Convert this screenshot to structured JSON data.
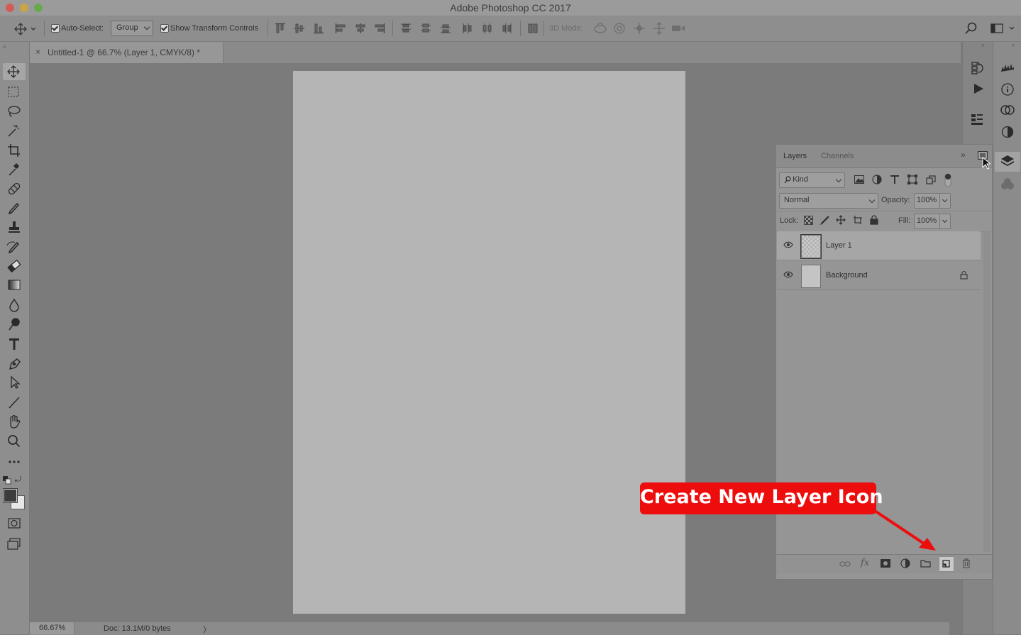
{
  "window": {
    "title": "Adobe Photoshop CC 2017"
  },
  "options_bar": {
    "auto_select_label": "Auto-Select:",
    "auto_select_value": "Group",
    "transform_controls_label": "Show Transform Controls",
    "mode_3d_label": "3D Mode:"
  },
  "document": {
    "tab_close": "×",
    "tab_title": "Untitled-1 @ 66.7% (Layer 1, CMYK/8) *"
  },
  "status_bar": {
    "zoom": "66.67%",
    "doc_info": "Doc: 13.1M/0 bytes",
    "arrow": "〉"
  },
  "layers_panel": {
    "tabs": [
      "Layers",
      "Channels"
    ],
    "filter_kind": "Kind",
    "blend_mode": "Normal",
    "opacity_label": "Opacity:",
    "opacity_value": "100%",
    "lock_label": "Lock:",
    "fill_label": "Fill:",
    "fill_value": "100%",
    "layers": [
      {
        "name": "Layer 1",
        "selected": true
      },
      {
        "name": "Background",
        "locked": true
      }
    ]
  },
  "callout": {
    "text": "Create New Layer Icon"
  },
  "colors": {
    "callout_red": "#ee0d0d",
    "document_bg": "#b5b5b5"
  }
}
